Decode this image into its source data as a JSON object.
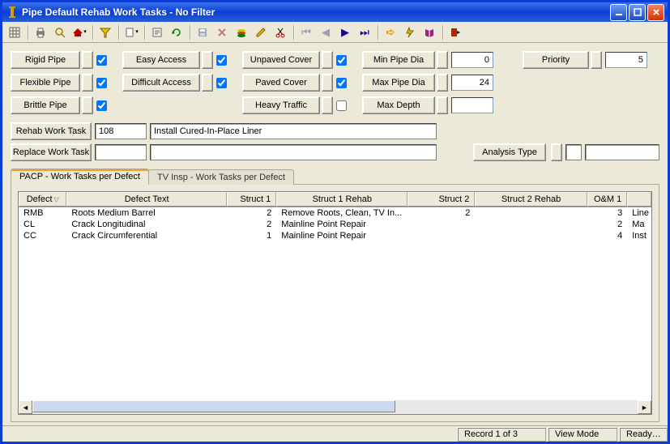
{
  "window": {
    "title": "Pipe Default Rehab Work Tasks - No Filter"
  },
  "filters": {
    "rigid_pipe": "Rigid Pipe",
    "flexible_pipe": "Flexible Pipe",
    "brittle_pipe": "Brittle Pipe",
    "easy_access": "Easy Access",
    "difficult_access": "Difficult Access",
    "unpaved_cover": "Unpaved Cover",
    "paved_cover": "Paved Cover",
    "heavy_traffic": "Heavy Traffic",
    "min_pipe_dia": "Min Pipe Dia",
    "max_pipe_dia": "Max Pipe Dia",
    "max_depth": "Max Depth",
    "priority": "Priority",
    "min_pipe_dia_val": "0",
    "max_pipe_dia_val": "24",
    "max_depth_val": "",
    "priority_val": "5"
  },
  "rehab": {
    "rehab_label": "Rehab Work Task",
    "rehab_code": "108",
    "rehab_desc": "Install Cured-In-Place Liner",
    "replace_label": "Replace Work Task",
    "replace_code": "",
    "replace_desc": "",
    "analysis_label": "Analysis Type",
    "analysis_code": "",
    "analysis_desc": ""
  },
  "tabs": {
    "pacp": "PACP - Work Tasks per Defect",
    "tv": "TV Insp - Work Tasks per Defect"
  },
  "grid": {
    "columns": {
      "defect": "Defect",
      "defect_text": "Defect Text",
      "struct1": "Struct 1",
      "struct1_rehab": "Struct 1 Rehab",
      "struct2": "Struct 2",
      "struct2_rehab": "Struct 2 Rehab",
      "om1": "O&M 1",
      "om1_rehab": ""
    },
    "rows": [
      {
        "defect": "RMB",
        "defect_text": "Roots Medium Barrel",
        "s1": "2",
        "s1r": "Remove Roots, Clean, TV In...",
        "s2": "2",
        "s2r": "",
        "om": "3",
        "omr": "Line"
      },
      {
        "defect": "CL",
        "defect_text": "Crack Longitudinal",
        "s1": "2",
        "s1r": "Mainline Point Repair",
        "s2": "",
        "s2r": "",
        "om": "2",
        "omr": "Ma"
      },
      {
        "defect": "CC",
        "defect_text": "Crack Circumferential",
        "s1": "1",
        "s1r": "Mainline Point Repair",
        "s2": "",
        "s2r": "",
        "om": "4",
        "omr": "Inst"
      }
    ]
  },
  "status": {
    "record": "Record 1 of 3",
    "mode": "View Mode",
    "ready": "Ready…"
  }
}
